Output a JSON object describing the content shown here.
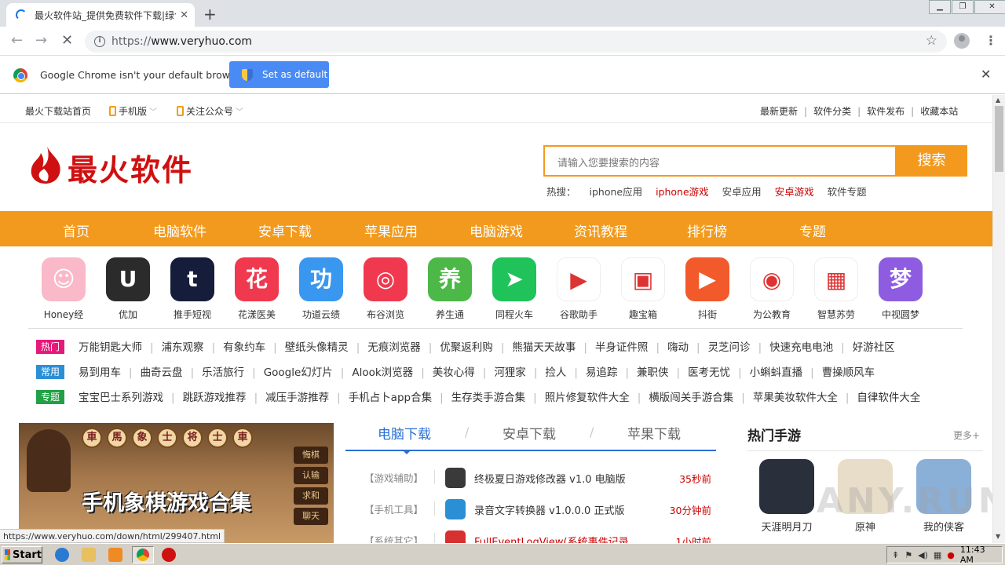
{
  "browser": {
    "tab_title": "最火软件站_提供免费软件下载|绿色",
    "tab_close": "✕",
    "new_tab": "+",
    "url_scheme": "https://",
    "url_host": "www.veryhuo.com",
    "infobar": {
      "message": "Google Chrome isn't your default browser",
      "button": "Set as default",
      "close": "✕"
    },
    "status_url": "https://www.veryhuo.com/down/html/299407.html"
  },
  "site": {
    "topnav": {
      "home": "最火下载站首页",
      "mobile": "手机版",
      "wechat": "关注公众号",
      "right_links": [
        "最新更新",
        "软件分类",
        "软件发布",
        "收藏本站"
      ]
    },
    "logo_text": "最火软件",
    "search": {
      "placeholder": "请输入您要搜索的内容",
      "button": "搜索",
      "hot_label": "热搜：",
      "hot_items": [
        {
          "label": "iphone应用",
          "highlight": false
        },
        {
          "label": "iphone游戏",
          "highlight": true
        },
        {
          "label": "安卓应用",
          "highlight": false
        },
        {
          "label": "安卓游戏",
          "highlight": true
        },
        {
          "label": "软件专题",
          "highlight": false
        }
      ]
    },
    "main_nav": [
      "首页",
      "电脑软件",
      "安卓下载",
      "苹果应用",
      "电脑游戏",
      "资讯教程",
      "排行榜",
      "专题"
    ],
    "apps": [
      {
        "name": "Honey经",
        "color": "#f9b9c8",
        "glyph": "☺"
      },
      {
        "name": "优加",
        "color": "#2b2b2b",
        "glyph": "U"
      },
      {
        "name": "推手短视",
        "color": "#161d3a",
        "glyph": "t"
      },
      {
        "name": "花漾医美",
        "color": "#f0384e",
        "glyph": "花"
      },
      {
        "name": "功道云绩",
        "color": "#3a97f0",
        "glyph": "功"
      },
      {
        "name": "布谷浏览",
        "color": "#f0384e",
        "glyph": "◎"
      },
      {
        "name": "养生通",
        "color": "#4cb848",
        "glyph": "养"
      },
      {
        "name": "同程火车",
        "color": "#20c35a",
        "glyph": "➤"
      },
      {
        "name": "谷歌助手",
        "color": "#ffffff",
        "glyph": "▶"
      },
      {
        "name": "趣宝箱",
        "color": "#ffffff",
        "glyph": "▣"
      },
      {
        "name": "抖街",
        "color": "#f25a2b",
        "glyph": "▶"
      },
      {
        "name": "为公教育",
        "color": "#ffffff",
        "glyph": "◉"
      },
      {
        "name": "智慧苏劳",
        "color": "#ffffff",
        "glyph": "▦"
      },
      {
        "name": "中视圆梦",
        "color": "#8e5ce0",
        "glyph": "梦"
      }
    ],
    "tag_rows": [
      {
        "tag": "热门",
        "color": "#e6197a",
        "items": [
          "万能钥匙大师",
          "浦东观察",
          "有象约车",
          "壁纸头像精灵",
          "无痕浏览器",
          "优聚返利购",
          "熊猫天天故事",
          "半身证件照",
          "嗨动",
          "灵芝问诊",
          "快速充电电池",
          "好游社区"
        ]
      },
      {
        "tag": "常用",
        "color": "#2b8fd6",
        "items": [
          "易到用车",
          "曲奇云盘",
          "乐活旅行",
          "Google幻灯片",
          "Alook浏览器",
          "美妆心得",
          "河狸家",
          "捡人",
          "易追踪",
          "兼职侠",
          "医考无忧",
          "小蝌蚪直播",
          "曹操顺风车"
        ]
      },
      {
        "tag": "专题",
        "color": "#21a045",
        "items": [
          "宝宝巴士系列游戏",
          "跳跃游戏推荐",
          "减压手游推荐",
          "手机占卜app合集",
          "生存类手游合集",
          "照片修复软件大全",
          "横版闯关手游合集",
          "苹果美妆软件大全",
          "自律软件大全"
        ]
      }
    ],
    "banner": {
      "title": "手机象棋游戏合集",
      "pieces": [
        "車",
        "馬",
        "象",
        "士",
        "将",
        "士",
        "車"
      ],
      "side_buttons": [
        "悔棋",
        "认输",
        "求和",
        "聊天"
      ]
    },
    "download": {
      "tabs": [
        "电脑下载",
        "安卓下载",
        "苹果下载"
      ],
      "active_tab": 0,
      "rows": [
        {
          "category": "【游戏辅助】",
          "name": "终极夏日游戏修改器 v1.0 电脑版",
          "time": "35秒前",
          "icon_color": "#3a3a3a"
        },
        {
          "category": "【手机工具】",
          "name": "录音文字转换器 v1.0.0.0 正式版",
          "time": "30分钟前",
          "icon_color": "#2b8fd6"
        },
        {
          "category": "【系统其它】",
          "name": "FullEventLogView(系统事件记录",
          "time": "1小时前",
          "icon_color": "#d63030"
        }
      ]
    },
    "hot_games": {
      "title": "热门手游",
      "more": "更多+",
      "items": [
        {
          "name": "天涯明月刀",
          "color": "#2a2f3c"
        },
        {
          "name": "原神",
          "color": "#e8ddc8"
        },
        {
          "name": "我的侠客",
          "color": "#8ab0d8"
        }
      ]
    },
    "watermark": "ANY.RUN"
  },
  "taskbar": {
    "start": "Start",
    "clock": "11:43 AM"
  }
}
